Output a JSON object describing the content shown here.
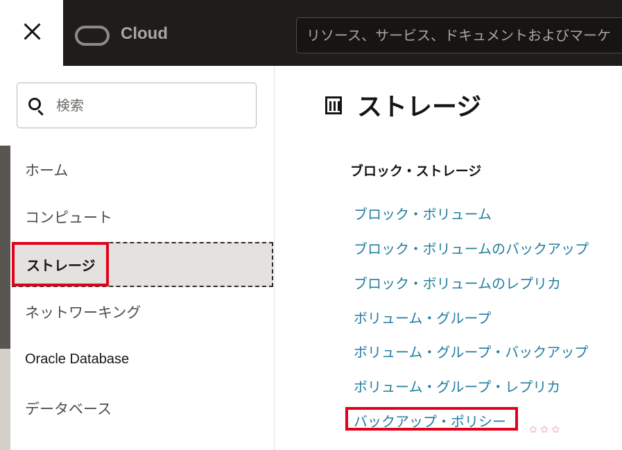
{
  "header": {
    "brand": "Cloud",
    "search_placeholder": "リソース、サービス、ドキュメントおよびマーケ"
  },
  "sidebar": {
    "search_placeholder": "検索",
    "items": [
      {
        "label": "ホーム"
      },
      {
        "label": "コンピュート"
      },
      {
        "label": "ストレージ",
        "selected": true
      },
      {
        "label": "ネットワーキング"
      },
      {
        "label": "Oracle Database"
      },
      {
        "label": "データベース"
      }
    ]
  },
  "main": {
    "title": "ストレージ",
    "section": {
      "title": "ブロック・ストレージ",
      "links": [
        "ブロック・ボリューム",
        "ブロック・ボリュームのバックアップ",
        "ブロック・ボリュームのレプリカ",
        "ボリューム・グループ",
        "ボリューム・グループ・バックアップ",
        "ボリューム・グループ・レプリカ",
        "バックアップ・ポリシー"
      ]
    }
  },
  "colors": {
    "topbar": "#1f1d1b",
    "link": "#227e9e",
    "highlight": "#e2001a",
    "selected_bg": "#e4e2de"
  }
}
